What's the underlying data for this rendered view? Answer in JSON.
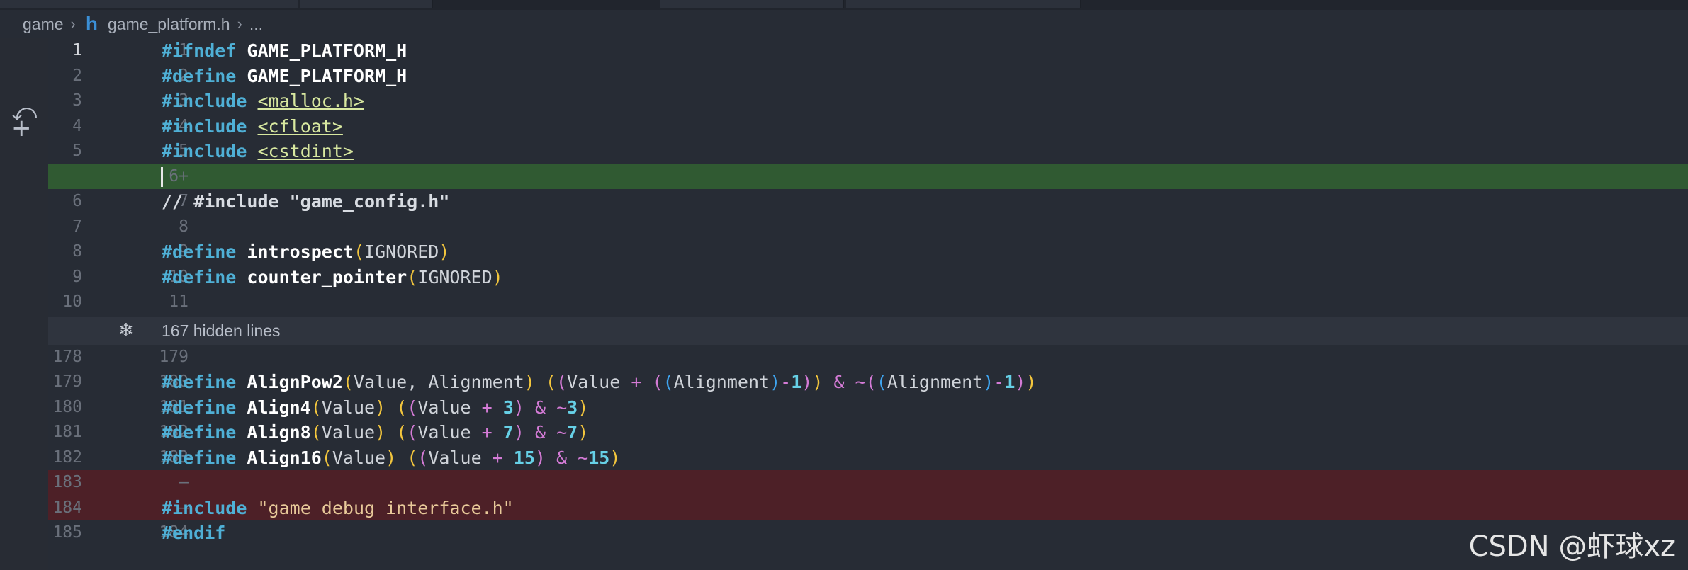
{
  "breadcrumb": {
    "folder": "game",
    "file": "game_platform.h",
    "more": "..."
  },
  "lines": [
    {
      "old": "1",
      "new": "1",
      "type": "context",
      "active": true,
      "tokens": [
        [
          "kw",
          "#ifndef"
        ],
        [
          "t",
          " "
        ],
        [
          "macro",
          "GAME_PLATFORM_H"
        ]
      ]
    },
    {
      "old": "2",
      "new": "2",
      "type": "context",
      "tokens": [
        [
          "kw",
          "#define"
        ],
        [
          "t",
          " "
        ],
        [
          "macro",
          "GAME_PLATFORM_H"
        ]
      ]
    },
    {
      "old": "3",
      "new": "3",
      "type": "context",
      "tokens": [
        [
          "kw",
          "#include"
        ],
        [
          "t",
          " "
        ],
        [
          "hdr",
          "<malloc.h>"
        ]
      ]
    },
    {
      "old": "4",
      "new": "4",
      "type": "context",
      "tokens": [
        [
          "kw",
          "#include"
        ],
        [
          "t",
          " "
        ],
        [
          "hdr",
          "<cfloat>"
        ]
      ]
    },
    {
      "old": "5",
      "new": "5",
      "type": "context",
      "tokens": [
        [
          "kw",
          "#include"
        ],
        [
          "t",
          " "
        ],
        [
          "hdr",
          "<cstdint>"
        ]
      ]
    },
    {
      "old": "",
      "new": "6+",
      "type": "added",
      "tokens": []
    },
    {
      "old": "6",
      "new": "7",
      "type": "context",
      "tokens": [
        [
          "cmt",
          "// #include \"game_config.h\""
        ]
      ]
    },
    {
      "old": "7",
      "new": "8",
      "type": "context",
      "tokens": []
    },
    {
      "old": "8",
      "new": "9",
      "type": "context",
      "tokens": [
        [
          "kw",
          "#define"
        ],
        [
          "t",
          " "
        ],
        [
          "macro",
          "introspect"
        ],
        [
          "p1",
          "("
        ],
        [
          "ident",
          "IGNORED"
        ],
        [
          "p1",
          ")"
        ]
      ]
    },
    {
      "old": "9",
      "new": "10",
      "type": "context",
      "tokens": [
        [
          "kw",
          "#define"
        ],
        [
          "t",
          " "
        ],
        [
          "macro",
          "counter_pointer"
        ],
        [
          "p1",
          "("
        ],
        [
          "ident",
          "IGNORED"
        ],
        [
          "p1",
          ")"
        ]
      ]
    },
    {
      "old": "10",
      "new": "11",
      "type": "context",
      "tokens": []
    }
  ],
  "folded": {
    "text": "167 hidden lines",
    "icon": "fold-expand-icon"
  },
  "lines2": [
    {
      "old": "178",
      "new": "179",
      "type": "context",
      "tokens": []
    },
    {
      "old": "179",
      "new": "180",
      "type": "context",
      "tokens": [
        [
          "kw",
          "#define"
        ],
        [
          "t",
          " "
        ],
        [
          "macro",
          "AlignPow2"
        ],
        [
          "p1",
          "("
        ],
        [
          "ident",
          "Value, Alignment"
        ],
        [
          "p1",
          ")"
        ],
        [
          "t",
          " "
        ],
        [
          "p1",
          "("
        ],
        [
          "p2",
          "("
        ],
        [
          "ident",
          "Value "
        ],
        [
          "op",
          "+"
        ],
        [
          "t",
          " "
        ],
        [
          "p2",
          "("
        ],
        [
          "p3",
          "("
        ],
        [
          "ident",
          "Alignment"
        ],
        [
          "p3",
          ")"
        ],
        [
          "op",
          "-"
        ],
        [
          "num",
          "1"
        ],
        [
          "p2",
          ")"
        ],
        [
          "p1",
          ")"
        ],
        [
          "t",
          " "
        ],
        [
          "op",
          "&"
        ],
        [
          "t",
          " "
        ],
        [
          "op",
          "~"
        ],
        [
          "p2",
          "("
        ],
        [
          "p3",
          "("
        ],
        [
          "ident",
          "Alignment"
        ],
        [
          "p3",
          ")"
        ],
        [
          "op",
          "-"
        ],
        [
          "num",
          "1"
        ],
        [
          "p2",
          ")"
        ],
        [
          "p1",
          ")"
        ]
      ]
    },
    {
      "old": "180",
      "new": "181",
      "type": "context",
      "tokens": [
        [
          "kw",
          "#define"
        ],
        [
          "t",
          " "
        ],
        [
          "macro",
          "Align4"
        ],
        [
          "p1",
          "("
        ],
        [
          "ident",
          "Value"
        ],
        [
          "p1",
          ")"
        ],
        [
          "t",
          " "
        ],
        [
          "p1",
          "("
        ],
        [
          "p2",
          "("
        ],
        [
          "ident",
          "Value "
        ],
        [
          "op",
          "+"
        ],
        [
          "t",
          " "
        ],
        [
          "num",
          "3"
        ],
        [
          "p2",
          ")"
        ],
        [
          "t",
          " "
        ],
        [
          "op",
          "&"
        ],
        [
          "t",
          " "
        ],
        [
          "op",
          "~"
        ],
        [
          "num",
          "3"
        ],
        [
          "p1",
          ")"
        ]
      ]
    },
    {
      "old": "181",
      "new": "182",
      "type": "context",
      "tokens": [
        [
          "kw",
          "#define"
        ],
        [
          "t",
          " "
        ],
        [
          "macro",
          "Align8"
        ],
        [
          "p1",
          "("
        ],
        [
          "ident",
          "Value"
        ],
        [
          "p1",
          ")"
        ],
        [
          "t",
          " "
        ],
        [
          "p1",
          "("
        ],
        [
          "p2",
          "("
        ],
        [
          "ident",
          "Value "
        ],
        [
          "op",
          "+"
        ],
        [
          "t",
          " "
        ],
        [
          "num",
          "7"
        ],
        [
          "p2",
          ")"
        ],
        [
          "t",
          " "
        ],
        [
          "op",
          "&"
        ],
        [
          "t",
          " "
        ],
        [
          "op",
          "~"
        ],
        [
          "num",
          "7"
        ],
        [
          "p1",
          ")"
        ]
      ]
    },
    {
      "old": "182",
      "new": "183",
      "type": "context",
      "tokens": [
        [
          "kw",
          "#define"
        ],
        [
          "t",
          " "
        ],
        [
          "macro",
          "Align16"
        ],
        [
          "p1",
          "("
        ],
        [
          "ident",
          "Value"
        ],
        [
          "p1",
          ")"
        ],
        [
          "t",
          " "
        ],
        [
          "p1",
          "("
        ],
        [
          "p2",
          "("
        ],
        [
          "ident",
          "Value "
        ],
        [
          "op",
          "+"
        ],
        [
          "t",
          " "
        ],
        [
          "num",
          "15"
        ],
        [
          "p2",
          ")"
        ],
        [
          "t",
          " "
        ],
        [
          "op",
          "&"
        ],
        [
          "t",
          " "
        ],
        [
          "op",
          "~"
        ],
        [
          "num",
          "15"
        ],
        [
          "p1",
          ")"
        ]
      ]
    },
    {
      "old": "183",
      "new": "—",
      "type": "removed",
      "tokens": []
    },
    {
      "old": "184",
      "new": "—",
      "type": "removed",
      "tokens": [
        [
          "kw",
          "#include"
        ],
        [
          "t",
          " "
        ],
        [
          "str",
          "\"game_debug_interface.h\""
        ]
      ]
    },
    {
      "old": "185",
      "new": "184",
      "type": "context",
      "tokens": [
        [
          "kw",
          "#endif"
        ]
      ]
    }
  ],
  "gutter_icons": [
    "revert-icon",
    "stage-plus-icon"
  ],
  "watermark": "CSDN @虾球xz"
}
